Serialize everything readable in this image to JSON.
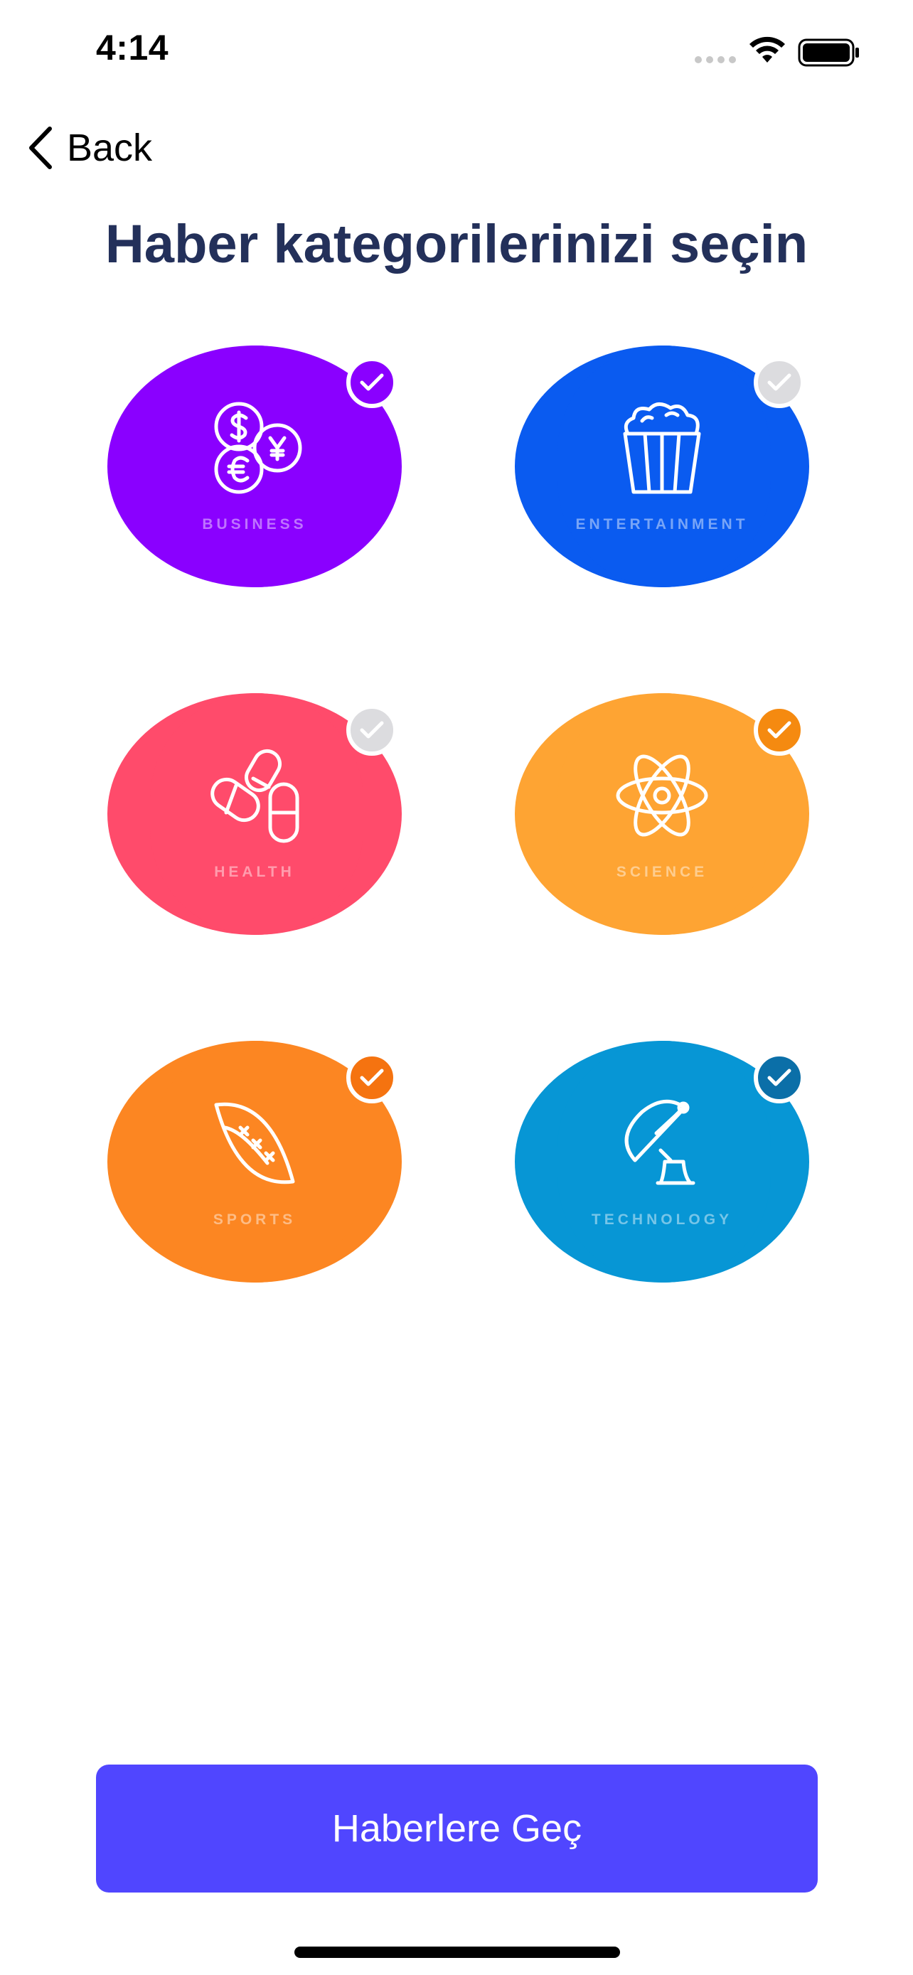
{
  "status_bar": {
    "time": "4:14"
  },
  "nav": {
    "back_label": "Back"
  },
  "title": "Haber kategorilerinizi seçin",
  "categories": [
    {
      "label": "BUSINESS",
      "icon": "currency-coins-icon",
      "color": "#8a00ff",
      "check_color": "#8a00ff",
      "selected": true
    },
    {
      "label": "ENTERTAINMENT",
      "icon": "popcorn-icon",
      "color": "#0a5bf0",
      "check_color": "#dcdcdf",
      "selected": false
    },
    {
      "label": "HEALTH",
      "icon": "pills-icon",
      "color": "#ff4b6b",
      "check_color": "#dcdcdf",
      "selected": false
    },
    {
      "label": "SCIENCE",
      "icon": "atom-icon",
      "color": "#fea433",
      "check_color": "#f58a10",
      "selected": true
    },
    {
      "label": "SPORTS",
      "icon": "football-icon",
      "color": "#fc8622",
      "check_color": "#f57310",
      "selected": true
    },
    {
      "label": "TECHNOLOGY",
      "icon": "satellite-dish-icon",
      "color": "#0796d5",
      "check_color": "#0b6fa8",
      "selected": true
    }
  ],
  "cta": {
    "label": "Haberlere Geç",
    "color": "#5046ff"
  }
}
